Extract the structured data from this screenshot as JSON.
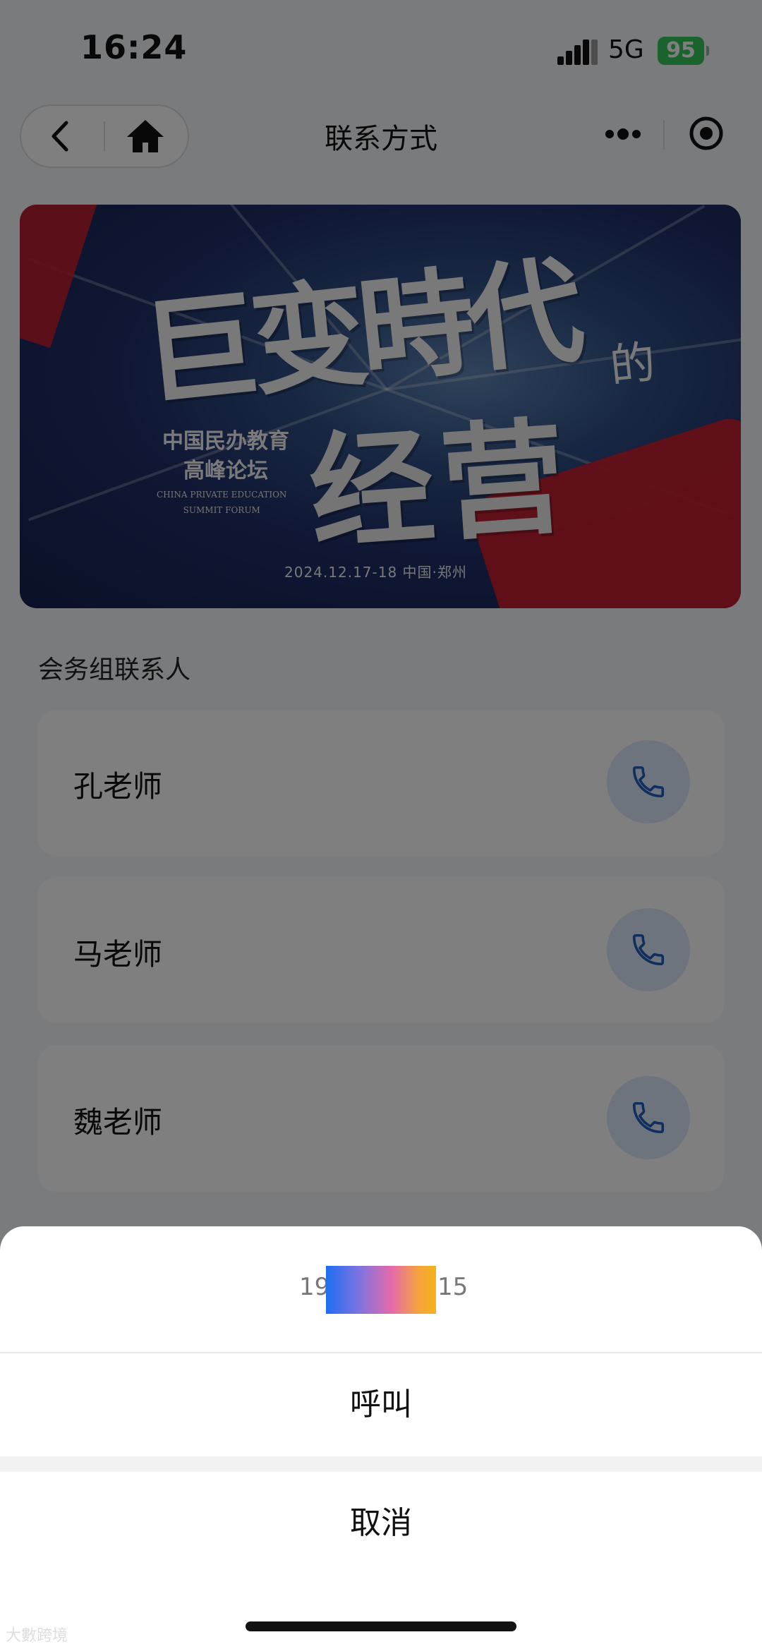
{
  "status_bar": {
    "time": "16:24",
    "network": "5G",
    "battery": "95"
  },
  "nav": {
    "title": "联系方式"
  },
  "banner": {
    "headline_1": "巨变時代",
    "headline_de": "的",
    "headline_2": "经营",
    "forum_line1": "中国民办教育",
    "forum_line2": "高峰论坛",
    "forum_en_line1": "CHINA PRIVATE EDUCATION",
    "forum_en_line2": "SUMMIT FORUM",
    "date_place": "2024.12.17-18   中国·郑州"
  },
  "section": {
    "title": "会务组联系人"
  },
  "contacts": [
    {
      "name": "孔老师"
    },
    {
      "name": "马老师"
    },
    {
      "name": "魏老师"
    }
  ],
  "action_sheet": {
    "phone_prefix": "19",
    "phone_suffix": "15",
    "call_label": "呼叫",
    "cancel_label": "取消"
  },
  "watermark": "大數跨境",
  "colors": {
    "accent_blue": "#1f5fbf",
    "battery_green": "#34c759"
  }
}
